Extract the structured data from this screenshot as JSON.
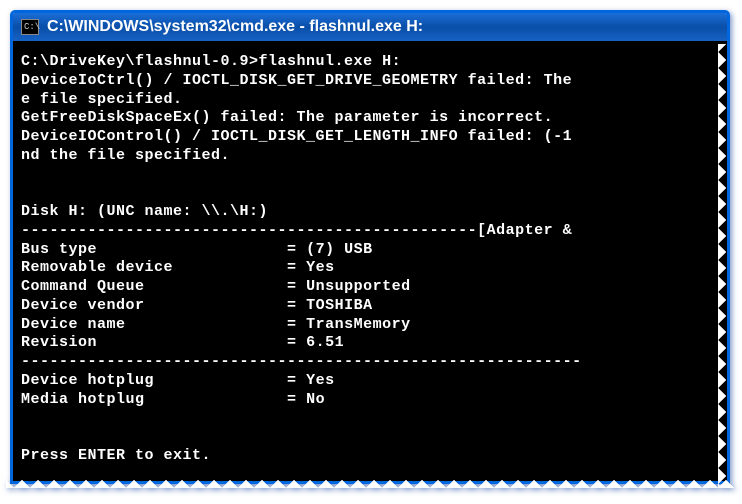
{
  "titlebar": {
    "icon_text": "C:\\",
    "title": "C:\\WINDOWS\\system32\\cmd.exe - flashnul.exe H:"
  },
  "console": {
    "prompt": "C:\\DriveKey\\flashnul-0.9>",
    "command": "flashnul.exe H:",
    "err1": "DeviceIoCtrl() / IOCTL_DISK_GET_DRIVE_GEOMETRY failed: The",
    "err1b": "e file specified.",
    "err2": "GetFreeDiskSpaceEx() failed: The parameter is incorrect.",
    "err3": "DeviceIOControl() / IOCTL_DISK_GET_LENGTH_INFO failed: (-1",
    "err3b": "nd the file specified.",
    "disk_header": "Disk H: (UNC name: \\\\.\\H:)",
    "section_adapter": "------------------------------------------------[Adapter &",
    "rows": [
      {
        "label": "Bus type",
        "value": "(7) USB"
      },
      {
        "label": "Removable device",
        "value": "Yes"
      },
      {
        "label": "Command Queue",
        "value": "Unsupported"
      },
      {
        "label": "Device vendor",
        "value": "TOSHIBA"
      },
      {
        "label": "Device name",
        "value": "TransMemory"
      },
      {
        "label": "Revision",
        "value": "6.51"
      }
    ],
    "divider": "-----------------------------------------------------------",
    "rows2": [
      {
        "label": "Device hotplug",
        "value": "Yes"
      },
      {
        "label": "Media hotplug",
        "value": "No"
      }
    ],
    "exit_prompt": "Press ENTER to exit."
  }
}
